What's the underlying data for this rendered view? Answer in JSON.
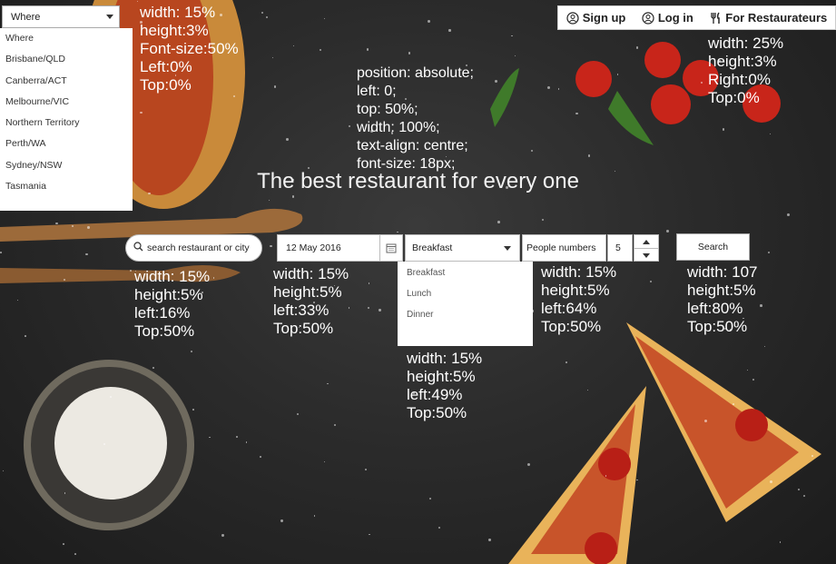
{
  "nav": {
    "signup_label": "Sign up",
    "login_label": "Log in",
    "restaurateurs_label": "For Restaurateurs"
  },
  "where": {
    "selected": "Where",
    "options": [
      "Where",
      "Brisbane/QLD",
      "Canberra/ACT",
      "Melbourne/VIC",
      "Northern Territory",
      "Perth/WA",
      "Sydney/NSW",
      "Tasmania"
    ]
  },
  "annotations": {
    "where_note": "width: 15%\nheight:3%\nFont-size:50%\nLeft:0%\nTop:0%",
    "nav_note": "width: 25%\nheight:3%\nRight:0%\nTop:0%",
    "headline_note": "position: absolute;\nleft: 0;\ntop: 50%;\nwidth: 100%;\ntext-align: centre;\nfont-size: 18px;",
    "search_note": "width: 15%\nheight:5%\nleft:16%\nTop:50%",
    "date_note": "width: 15%\nheight:5%\nleft:33%\nTop:50%",
    "meal_note": "width: 15%\nheight:5%\nleft:49%\nTop:50%",
    "people_note": "width: 15%\nheight:5%\nleft:64%\nTop:50%",
    "button_note": "width: 107\nheight:5%\nleft:80%\nTop:50%"
  },
  "headline": "The best restaurant for every one",
  "search": {
    "placeholder": "search restaurant or city",
    "date_value": "12 May 2016",
    "meal_selected": "Breakfast",
    "meal_options": [
      "Breakfast",
      "Lunch",
      "Dinner"
    ],
    "people_label": "People numbers",
    "people_value": "5",
    "button_label": "Search"
  }
}
